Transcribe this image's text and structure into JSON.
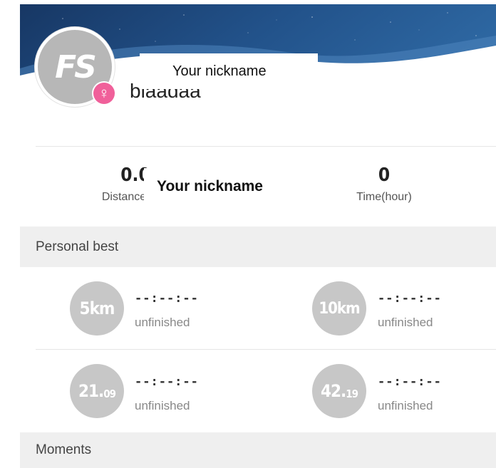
{
  "profile": {
    "avatar_logo": "FS",
    "gender_icon": "female-icon",
    "gender_symbol": "♀",
    "nickname": "biaadaa",
    "nickname_tooltip": "Your nickname"
  },
  "stats": {
    "distance_value": "0.0",
    "distance_label": "Distance(km)",
    "time_value": "0",
    "time_label": "Time(hour)",
    "overlay_tooltip": "Your nickname"
  },
  "personal_best": {
    "title": "Personal best",
    "items": [
      {
        "badge": "5km",
        "badge_small": "",
        "time": "--:--:--",
        "status": "unfinished"
      },
      {
        "badge": "10km",
        "badge_small": "",
        "time": "--:--:--",
        "status": "unfinished"
      },
      {
        "badge": "21.",
        "badge_small": "09",
        "time": "--:--:--",
        "status": "unfinished"
      },
      {
        "badge": "42.",
        "badge_small": "19",
        "time": "--:--:--",
        "status": "unfinished"
      }
    ]
  },
  "moments": {
    "title": "Moments"
  },
  "colors": {
    "banner_dark": "#183a68",
    "banner_light": "#2e6aa6",
    "badge_grey": "#c7c7c7",
    "gender_pink": "#f0609a",
    "section_bg": "#efefef"
  }
}
